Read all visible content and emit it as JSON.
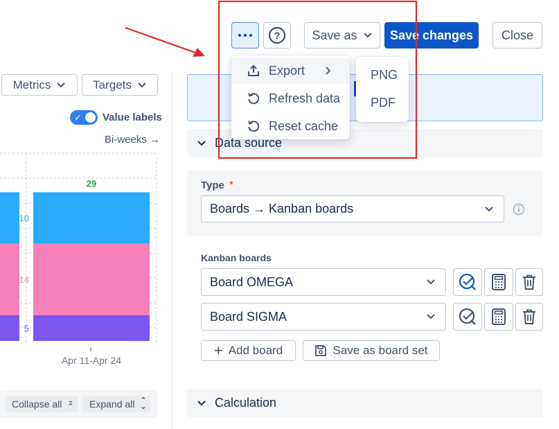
{
  "toolbar": {
    "save_as_label": "Save as",
    "save_changes_label": "Save changes",
    "close_label": "Close"
  },
  "more_menu": {
    "items": [
      {
        "label": "Export",
        "icon": "export-icon"
      },
      {
        "label": "Refresh data",
        "icon": "refresh-icon"
      },
      {
        "label": "Reset cache",
        "icon": "reset-icon"
      }
    ],
    "export_submenu": [
      "PNG",
      "PDF"
    ]
  },
  "filters": {
    "metrics_label": "Metrics",
    "targets_label": "Targets",
    "value_labels_label": "Value labels",
    "period_label": "Bi-weeks →"
  },
  "chart_data": {
    "type": "bar",
    "stacked": true,
    "categories": [
      "",
      "Apr 11-Apr 24"
    ],
    "series": [
      {
        "values": [
          5,
          5
        ],
        "color": "#7c55f0"
      },
      {
        "values": [
          14,
          14
        ],
        "color": "#f47fb9"
      },
      {
        "values": [
          10,
          10
        ],
        "color": "#2aabfb"
      }
    ],
    "totals": [
      "",
      "29"
    ],
    "total_color": "#22a35a",
    "grid": true
  },
  "chart_footer": {
    "collapse_all_label": "Collapse all",
    "expand_all_label": "Expand all"
  },
  "data_source": {
    "section_title": "Data source",
    "type_label": "Type",
    "required_mark": "*",
    "type_value": "Boards → Kanban boards",
    "boards_label": "Kanban boards",
    "boards": [
      "Board OMEGA",
      "Board SIGMA"
    ],
    "add_board_label": "Add board",
    "save_board_set_label": "Save as board set"
  },
  "calculation": {
    "section_title": "Calculation"
  },
  "colors": {
    "primary": "#0c56c7",
    "annotation_red": "#d92b2b",
    "toggle_on": "#2f7df6"
  }
}
